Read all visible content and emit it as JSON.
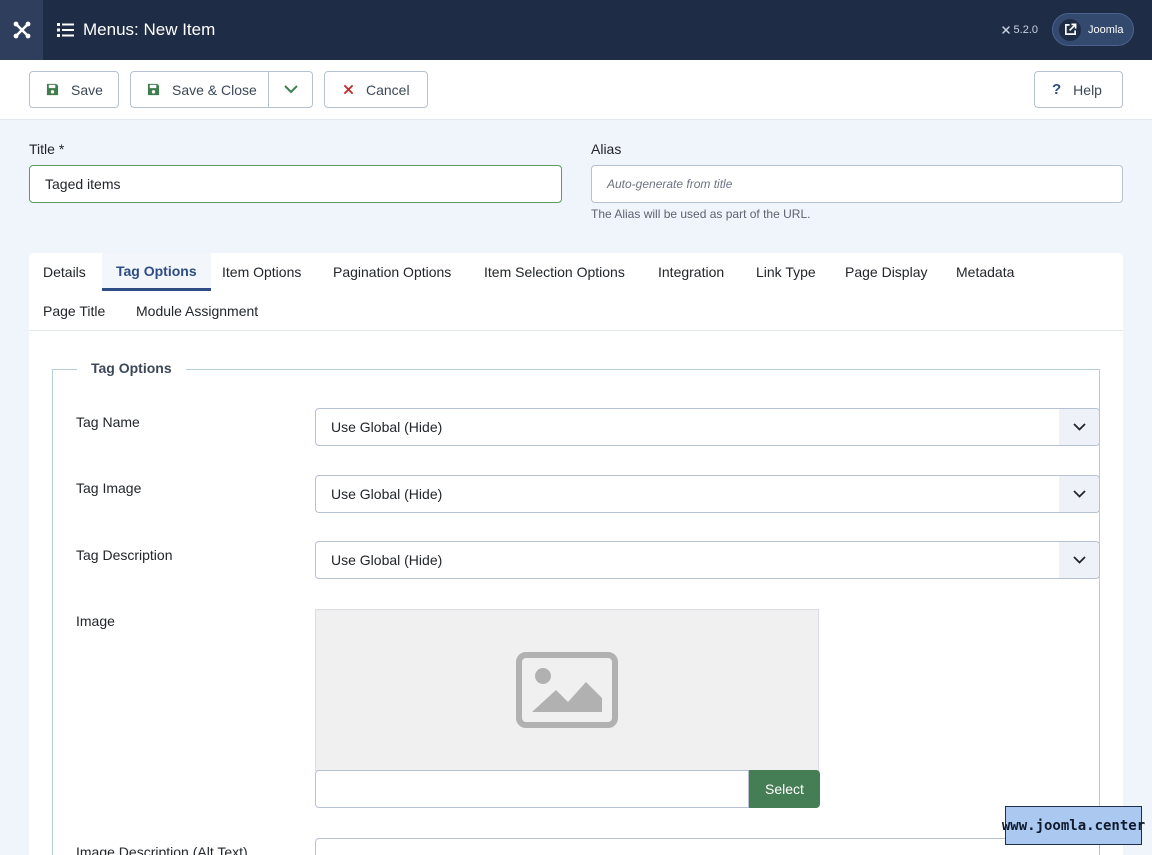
{
  "header": {
    "title": "Menus: New Item",
    "version": "5.2.0",
    "site_link": "Joomla"
  },
  "toolbar": {
    "save_label": "Save",
    "save_close_label": "Save & Close",
    "cancel_label": "Cancel",
    "help_label": "Help"
  },
  "form": {
    "title_label": "Title *",
    "title_value": "Taged items",
    "alias_label": "Alias",
    "alias_placeholder": "Auto-generate from title",
    "alias_hint": "The Alias will be used as part of the URL."
  },
  "tabs": [
    {
      "label": "Details"
    },
    {
      "label": "Tag Options"
    },
    {
      "label": "Item Options"
    },
    {
      "label": "Pagination Options"
    },
    {
      "label": "Item Selection Options"
    },
    {
      "label": "Integration"
    },
    {
      "label": "Link Type"
    },
    {
      "label": "Page Display"
    },
    {
      "label": "Metadata"
    },
    {
      "label": "Page Title"
    },
    {
      "label": "Module Assignment"
    }
  ],
  "active_tab": "Tag Options",
  "tag_options": {
    "legend": "Tag Options",
    "fields": [
      {
        "label": "Tag Name",
        "value": "Use Global (Hide)"
      },
      {
        "label": "Tag Image",
        "value": "Use Global (Hide)"
      },
      {
        "label": "Tag Description",
        "value": "Use Global (Hide)"
      }
    ],
    "image_label": "Image",
    "select_button": "Select",
    "alt_label": "Image Description (Alt Text)"
  },
  "watermark": "www.joomla.center",
  "colors": {
    "header_bg": "#1f2c45",
    "accent": "#2d4d84",
    "select_button": "#457d54",
    "cancel_icon": "#c52827"
  }
}
